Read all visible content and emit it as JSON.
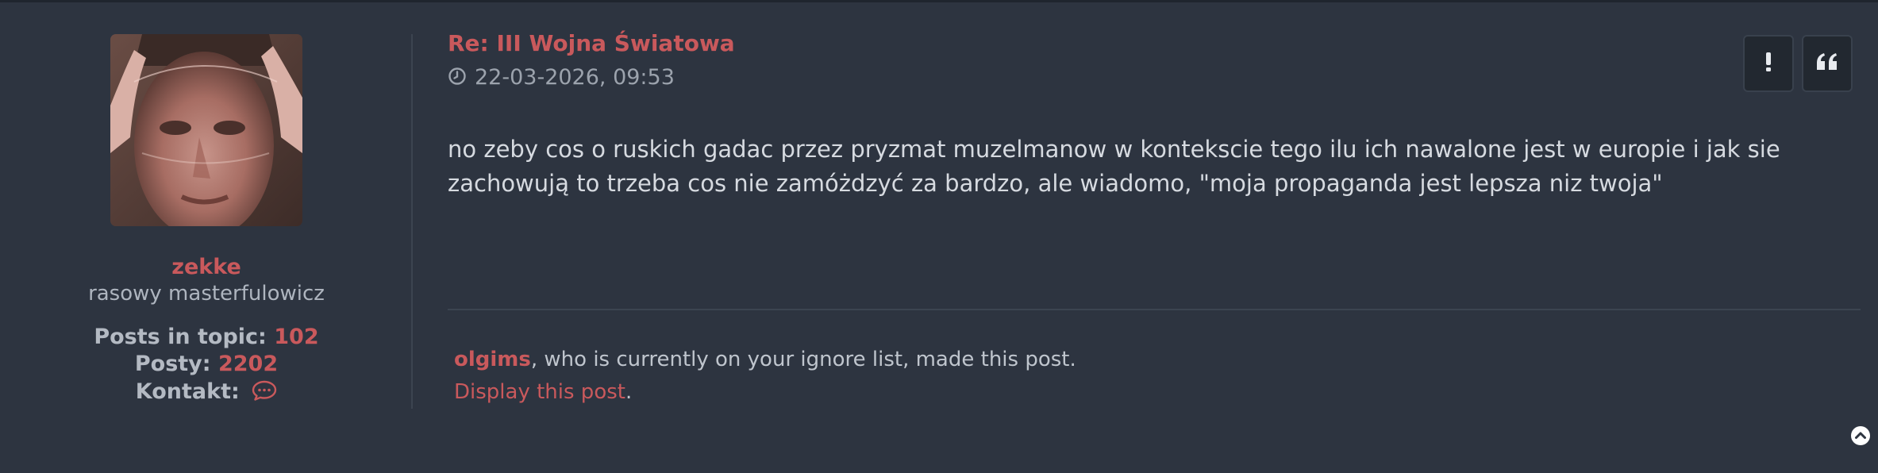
{
  "post": {
    "title": "Re: III Wojna Światowa",
    "date": "22-03-2026, 09:53",
    "body": "no zeby cos o ruskich gadac przez pryzmat muzelmanow w kontekscie tego ilu ich nawalone jest w europie i jak sie zachowują to trzeba cos nie zamóżdzyć za bardzo, ale wiadomo, \"moja propaganda jest lepsza niz twoja\""
  },
  "author": {
    "username": "zekke",
    "rank": "rasowy masterfulowicz",
    "posts_in_topic_label": "Posts in topic:",
    "posts_in_topic_value": "102",
    "posts_label": "Posty:",
    "posts_value": "2202",
    "contact_label": "Kontakt:",
    "contact_icon": "chat-bubble-icon"
  },
  "ignore_notice": {
    "user": "olgims",
    "text": ", who is currently on your ignore list, made this post.",
    "display_link": "Display this post",
    "trailing": "."
  },
  "buttons": {
    "report_icon": "exclamation-icon",
    "quote_icon": "quote-icon",
    "top_icon": "chevron-up-circle-icon"
  },
  "colors": {
    "background": "#2d3440",
    "accent": "#c9595c",
    "text": "#d6dae0",
    "muted": "#9ca3ad"
  }
}
